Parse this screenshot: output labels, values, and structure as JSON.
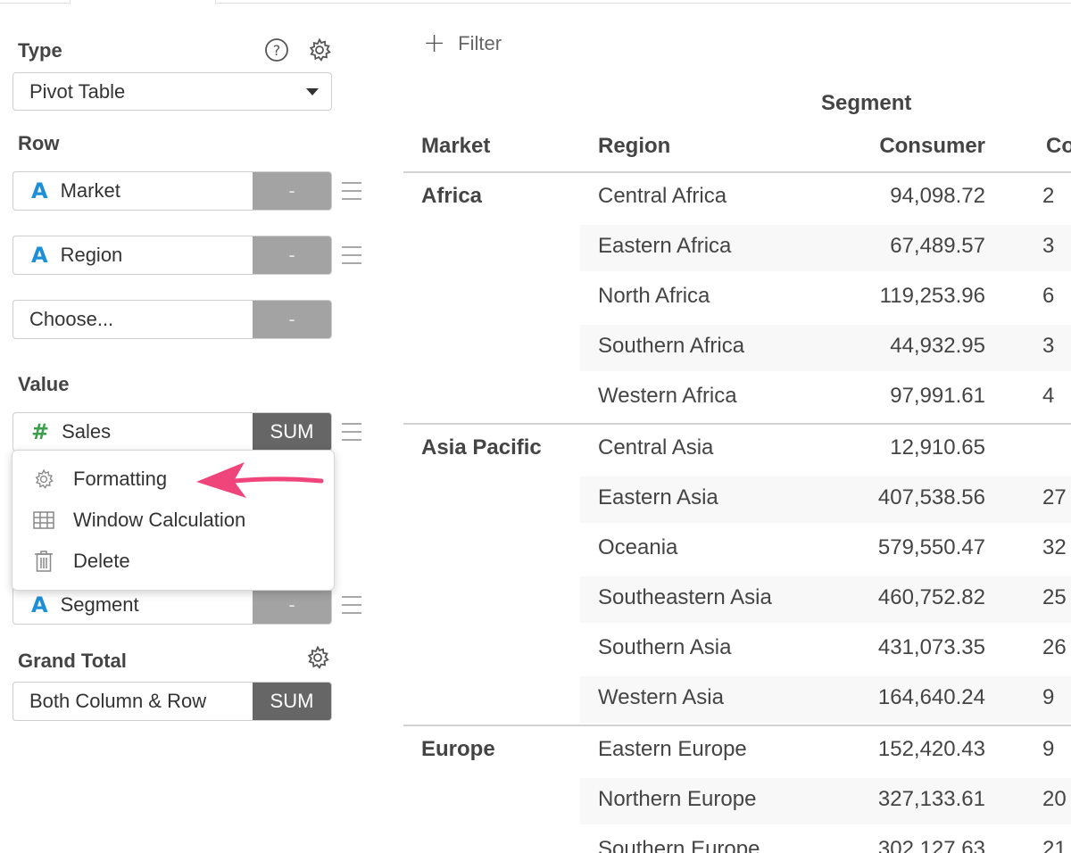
{
  "panel": {
    "type_label": "Type",
    "type_value": "Pivot Table",
    "row_label": "Row",
    "rows": [
      {
        "type_icon": "A",
        "label": "Market",
        "action": "-"
      },
      {
        "type_icon": "A",
        "label": "Region",
        "action": "-"
      },
      {
        "label": "Choose...",
        "action": "-"
      }
    ],
    "value_label": "Value",
    "value_field": {
      "type_icon": "#",
      "label": "Sales",
      "action": "SUM"
    },
    "column_field": {
      "type_icon": "A",
      "label": "Segment",
      "action": "-"
    },
    "grand_total_label": "Grand Total",
    "grand_total": {
      "label": "Both Column & Row",
      "action": "SUM"
    }
  },
  "menu": {
    "items": [
      {
        "label": "Formatting",
        "icon": "gear-icon"
      },
      {
        "label": "Window Calculation",
        "icon": "table-icon"
      },
      {
        "label": "Delete",
        "icon": "trash-icon"
      }
    ]
  },
  "toolbar": {
    "filter_label": "Filter"
  },
  "table": {
    "column_group": "Segment",
    "headers": {
      "market": "Market",
      "region": "Region",
      "consumer": "Consumer",
      "corporate": "Co"
    },
    "groups": [
      {
        "market": "Africa",
        "rows": [
          {
            "region": "Central Africa",
            "consumer": "94,098.72",
            "corporate": "2"
          },
          {
            "region": "Eastern Africa",
            "consumer": "67,489.57",
            "corporate": "3"
          },
          {
            "region": "North Africa",
            "consumer": "119,253.96",
            "corporate": "6"
          },
          {
            "region": "Southern Africa",
            "consumer": "44,932.95",
            "corporate": "3"
          },
          {
            "region": "Western Africa",
            "consumer": "97,991.61",
            "corporate": "4"
          }
        ]
      },
      {
        "market": "Asia Pacific",
        "rows": [
          {
            "region": "Central Asia",
            "consumer": "12,910.65",
            "corporate": ""
          },
          {
            "region": "Eastern Asia",
            "consumer": "407,538.56",
            "corporate": "27"
          },
          {
            "region": "Oceania",
            "consumer": "579,550.47",
            "corporate": "32"
          },
          {
            "region": "Southeastern Asia",
            "consumer": "460,752.82",
            "corporate": "25"
          },
          {
            "region": "Southern Asia",
            "consumer": "431,073.35",
            "corporate": "26"
          },
          {
            "region": "Western Asia",
            "consumer": "164,640.24",
            "corporate": "9"
          }
        ]
      },
      {
        "market": "Europe",
        "rows": [
          {
            "region": "Eastern Europe",
            "consumer": "152,420.43",
            "corporate": "9"
          },
          {
            "region": "Northern Europe",
            "consumer": "327,133.61",
            "corporate": "20"
          },
          {
            "region": "Southern Europe",
            "consumer": "302,127.63",
            "corporate": "21"
          }
        ]
      }
    ]
  }
}
